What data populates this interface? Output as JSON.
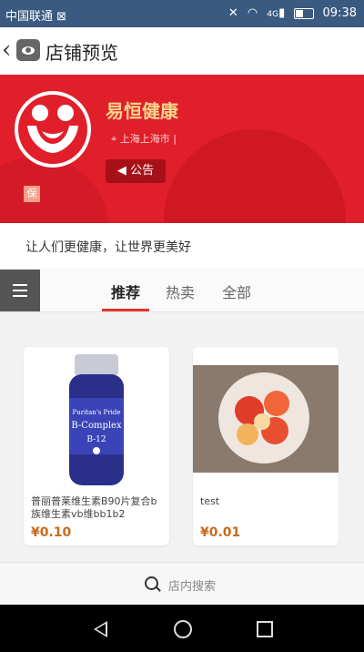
{
  "status_bar": {
    "carrier": "中国联通 ⊠",
    "time": "09:38",
    "net": "4G"
  },
  "header": {
    "back_icon": "chevron-left-icon",
    "preview_icon": "eye-icon",
    "title": "店铺预览"
  },
  "shop": {
    "name": "易恒健康",
    "location": "上海上海市",
    "notice_label": "公告",
    "tag": "保",
    "slogan": "让人们更健康，让世界更美好",
    "brand_color": "#e01f2b"
  },
  "tabs": {
    "items": [
      "推荐",
      "热卖",
      "全部"
    ],
    "active": "推荐"
  },
  "products": [
    {
      "name": "普丽普莱维生素B90片复合b族维生素vb维bb1b2",
      "price": "¥0.10"
    },
    {
      "name": "test",
      "price": "¥0.01"
    }
  ],
  "search": {
    "placeholder": "店内搜索"
  }
}
